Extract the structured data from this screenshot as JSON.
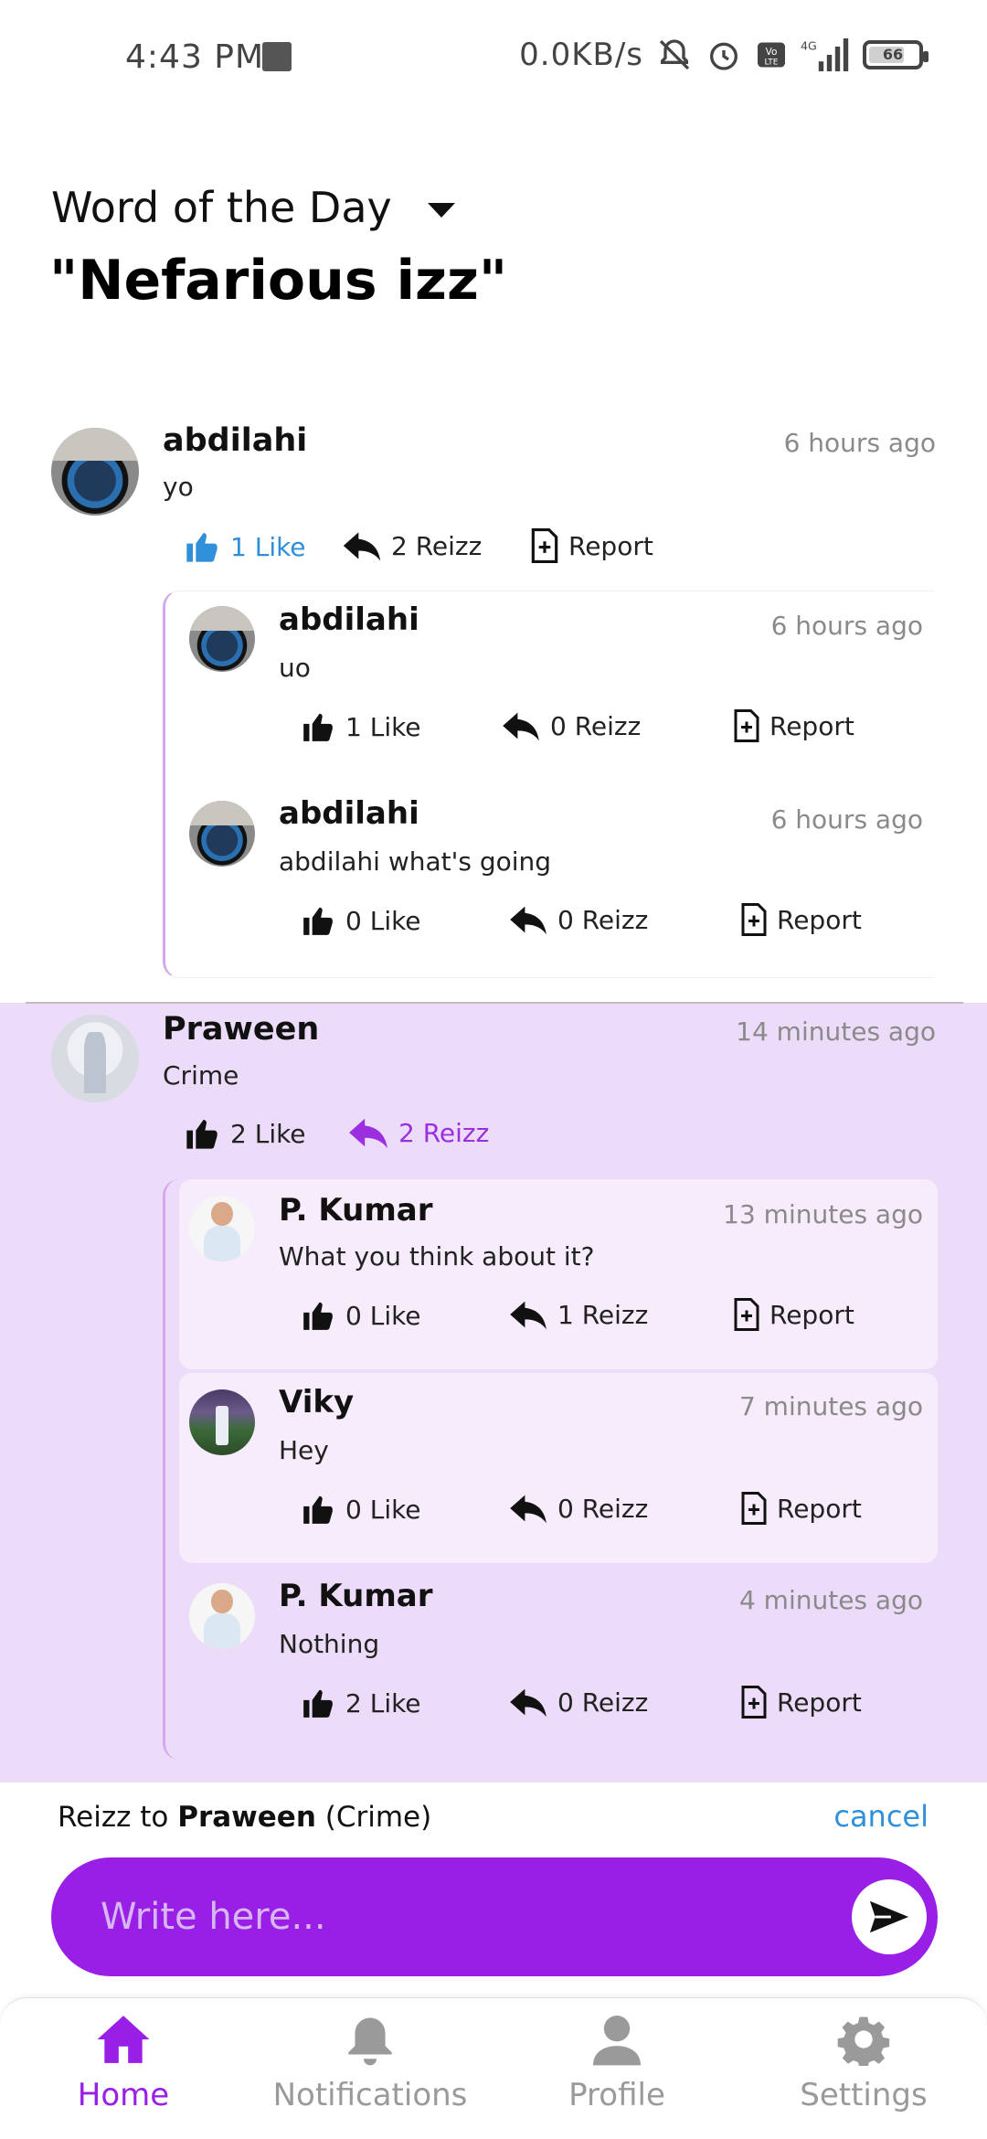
{
  "status_bar": {
    "time": "4:43 PM",
    "speed": "0.0KB/s",
    "battery": "66",
    "network": "4G"
  },
  "header": {
    "label": "Word of the Day",
    "word": "\"Nefarious izz\""
  },
  "comments": [
    {
      "name": "abdilahi",
      "time": "6 hours ago",
      "text": "yo",
      "like": "1 Like",
      "reizz": "2 Reizz",
      "report": "Report",
      "replies": [
        {
          "name": "abdilahi",
          "time": "6 hours ago",
          "text": "uo",
          "like": "1 Like",
          "reizz": "0 Reizz",
          "report": "Report"
        },
        {
          "name": "abdilahi",
          "time": "6 hours ago",
          "text": "abdilahi what's going",
          "like": "0 Like",
          "reizz": "0 Reizz",
          "report": "Report"
        }
      ]
    },
    {
      "name": "Praween",
      "time": "14 minutes ago",
      "text": "Crime",
      "like": "2 Like",
      "reizz": "2 Reizz",
      "replies": [
        {
          "name": "P. Kumar",
          "time": "13 minutes ago",
          "text": "What you think about it?",
          "like": "0 Like",
          "reizz": "1 Reizz",
          "report": "Report"
        },
        {
          "name": "Viky",
          "time": "7 minutes ago",
          "text": "Hey",
          "like": "0 Like",
          "reizz": "0 Reizz",
          "report": "Report"
        },
        {
          "name": "P. Kumar",
          "time": "4 minutes ago",
          "text": "Nothing",
          "like": "2 Like",
          "reizz": "0 Reizz",
          "report": "Report"
        }
      ]
    }
  ],
  "composer": {
    "reply_prefix": "Reizz to",
    "reply_name": "Praween",
    "reply_context": "(Crime)",
    "cancel": "cancel",
    "placeholder": "Write here..."
  },
  "nav": [
    {
      "label": "Home",
      "icon": "home-icon",
      "active": true
    },
    {
      "label": "Notifications",
      "icon": "bell-icon"
    },
    {
      "label": "Profile",
      "icon": "person-icon"
    },
    {
      "label": "Settings",
      "icon": "gear-icon"
    }
  ],
  "colors": {
    "accent": "#9a1fe6",
    "link": "#2f8fd8",
    "highlight_bg": "#ecdcf9",
    "reply_bg": "#f6ecfc"
  }
}
